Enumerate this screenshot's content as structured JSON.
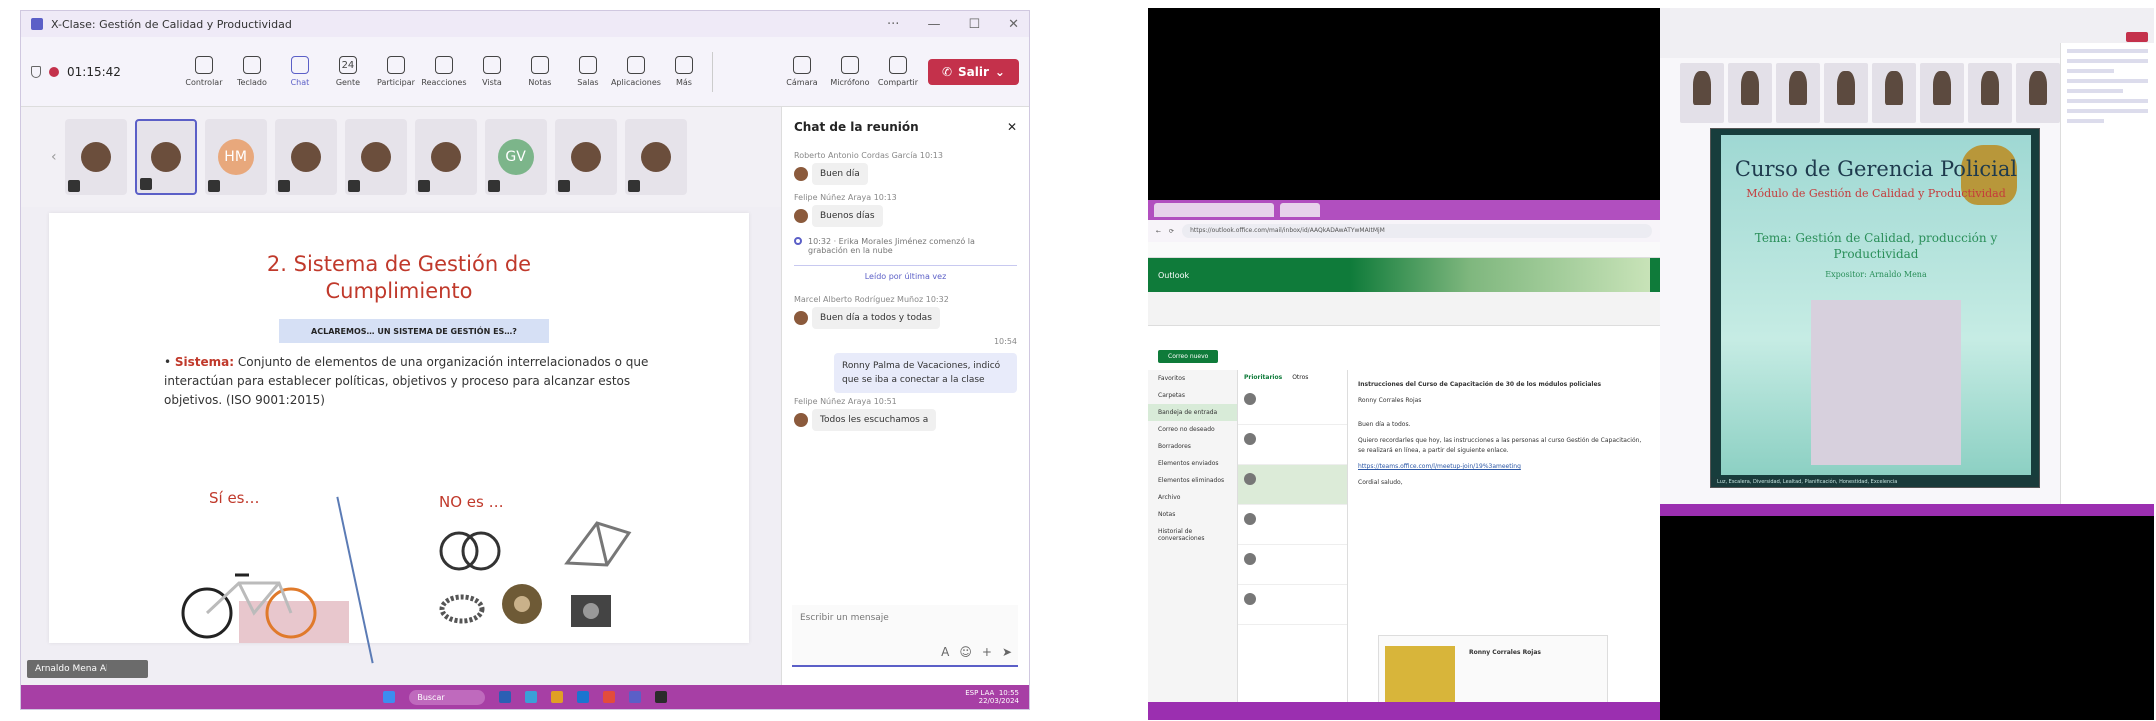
{
  "left": {
    "window_title": "X-Clase: Gestión de Calidad y Productividad",
    "meeting_timer": "01:15:42",
    "toolbar": [
      {
        "label": "Controlar",
        "icon": "control-icon"
      },
      {
        "label": "Teclado",
        "icon": "keyboard-icon"
      },
      {
        "label": "Chat",
        "icon": "chat-icon",
        "active": true
      },
      {
        "label": "Gente",
        "icon": "people-icon",
        "badge": "24"
      },
      {
        "label": "Participar",
        "icon": "hand-icon"
      },
      {
        "label": "Reacciones",
        "icon": "smile-icon"
      },
      {
        "label": "Vista",
        "icon": "view-icon"
      },
      {
        "label": "Notas",
        "icon": "notes-icon"
      },
      {
        "label": "Salas",
        "icon": "rooms-icon"
      },
      {
        "label": "Aplicaciones",
        "icon": "apps-icon"
      },
      {
        "label": "Más",
        "icon": "more-icon"
      }
    ],
    "devices": [
      {
        "label": "Cámara",
        "icon": "camera-icon"
      },
      {
        "label": "Micrófono",
        "icon": "mic-icon"
      },
      {
        "label": "Compartir",
        "icon": "share-icon"
      }
    ],
    "leave_label": "Salir",
    "participants": [
      {
        "kind": "photo"
      },
      {
        "kind": "photo",
        "selected": true
      },
      {
        "kind": "initials",
        "text": "HM",
        "color": "#e8a87c"
      },
      {
        "kind": "photo"
      },
      {
        "kind": "photo"
      },
      {
        "kind": "photo"
      },
      {
        "kind": "initials",
        "text": "GV",
        "color": "#7cb58a"
      },
      {
        "kind": "photo"
      },
      {
        "kind": "photo"
      }
    ],
    "slide": {
      "title_line1": "2. Sistema de Gestión de",
      "title_line2": "Cumplimiento",
      "box": "ACLAREMOS… UN SISTEMA DE GESTIÓN ES…?",
      "term": "Sistema:",
      "definition": "Conjunto de elementos de una organización interrelacionados o que interactúan para establecer políticas, objetivos y proceso para alcanzar estos objetivos. (ISO 9001:2015)",
      "yes": "Sí es…",
      "no": "NO es …"
    },
    "presenter_tag": "Arnaldo Mena Alvarado",
    "chat": {
      "title": "Chat de la reunión",
      "messages": [
        {
          "meta": "Roberto Antonio Cordas García  10:13",
          "text": "Buen día"
        },
        {
          "meta": "Felipe Núñez Araya  10:13",
          "text": "Buenos días"
        }
      ],
      "system_note": "10:32 · Erika Morales Jiménez comenzó la grabación en la nube",
      "last_read": "Leído por última vez",
      "messages2": [
        {
          "meta": "Marcel Alberto Rodríguez Muñoz  10:32",
          "text": "Buen día a todos y todas"
        }
      ],
      "my_time": "10:54",
      "my_message": "Ronny Palma de Vacaciones, indicó que se iba a conectar a la clase",
      "messages3": [
        {
          "meta": "Felipe Núñez Araya  10:51",
          "text": "Todos les escuchamos a"
        }
      ],
      "composer_placeholder": "Escribir un mensaje"
    },
    "taskbar_search": "Buscar",
    "tray_time": "10:55",
    "tray_date": "22/03/2024",
    "tray_lang": "ESP LAA"
  },
  "right": {
    "browser_url": "https://outlook.office.com/mail/inbox/id/AAQkADAwATYwMAItMjM",
    "outlook_title": "Outlook",
    "new_mail": "Correo nuevo",
    "folders": [
      "Favoritos",
      "Carpetas",
      "Bandeja de entrada",
      "Correo no deseado",
      "Borradores",
      "Elementos enviados",
      "Elementos eliminados",
      "Archivo",
      "Notas",
      "Historial de conversaciones"
    ],
    "tabs": [
      "Prioritarios",
      "Otros"
    ],
    "email_subject": "Instrucciones del Curso de Capacitación de 30 de los módulos policiales",
    "email_sender": "Ronny Corrales Rojas",
    "email_body1": "Buen día a todos.",
    "email_body2": "Quiero recordarles que hoy, las instrucciones a las personas al curso Gestión de Capacitación, se realizará en línea, a partir del siguiente enlace.",
    "email_link": "https://teams.office.com/l/meetup-join/19%3ameeting",
    "email_sign": "Cordial saludo,",
    "card_name": "Ronny Corrales Rojas",
    "pres_title": "Curso de Gerencia Policial",
    "pres_module": "Módulo de Gestión de Calidad y Productividad",
    "pres_topic": "Tema: Gestión de Calidad, producción y Productividad",
    "pres_speaker": "Expositor: Arnaldo Mena",
    "pres_footer": "Luz, Escalera, Diversidad, Lealtad, Planificación, Honestidad, Excelencia"
  }
}
